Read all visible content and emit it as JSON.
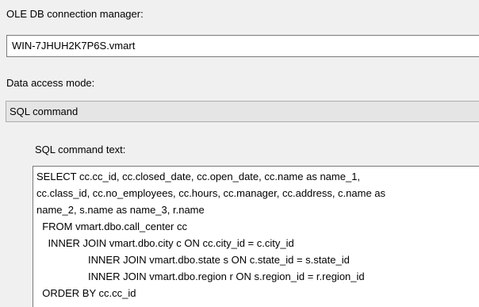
{
  "connection_manager": {
    "label": "OLE DB connection manager:",
    "value": "WIN-7JHUH2K7P6S.vmart"
  },
  "data_access_mode": {
    "label": "Data access mode:",
    "value": "SQL command"
  },
  "sql_command": {
    "label": "SQL command text:",
    "lines": [
      "SELECT cc.cc_id, cc.closed_date, cc.open_date, cc.name as name_1,",
      "cc.class_id, cc.no_employees, cc.hours, cc.manager, cc.address, c.name as",
      "name_2, s.name as name_3, r.name",
      "  FROM vmart.dbo.call_center cc",
      "    INNER JOIN vmart.dbo.city c ON cc.city_id = c.city_id",
      "                  INNER JOIN vmart.dbo.state s ON c.state_id = s.state_id",
      "                  INNER JOIN vmart.dbo.region r ON s.region_id = r.region_id",
      "  ORDER BY cc.cc_id"
    ]
  }
}
